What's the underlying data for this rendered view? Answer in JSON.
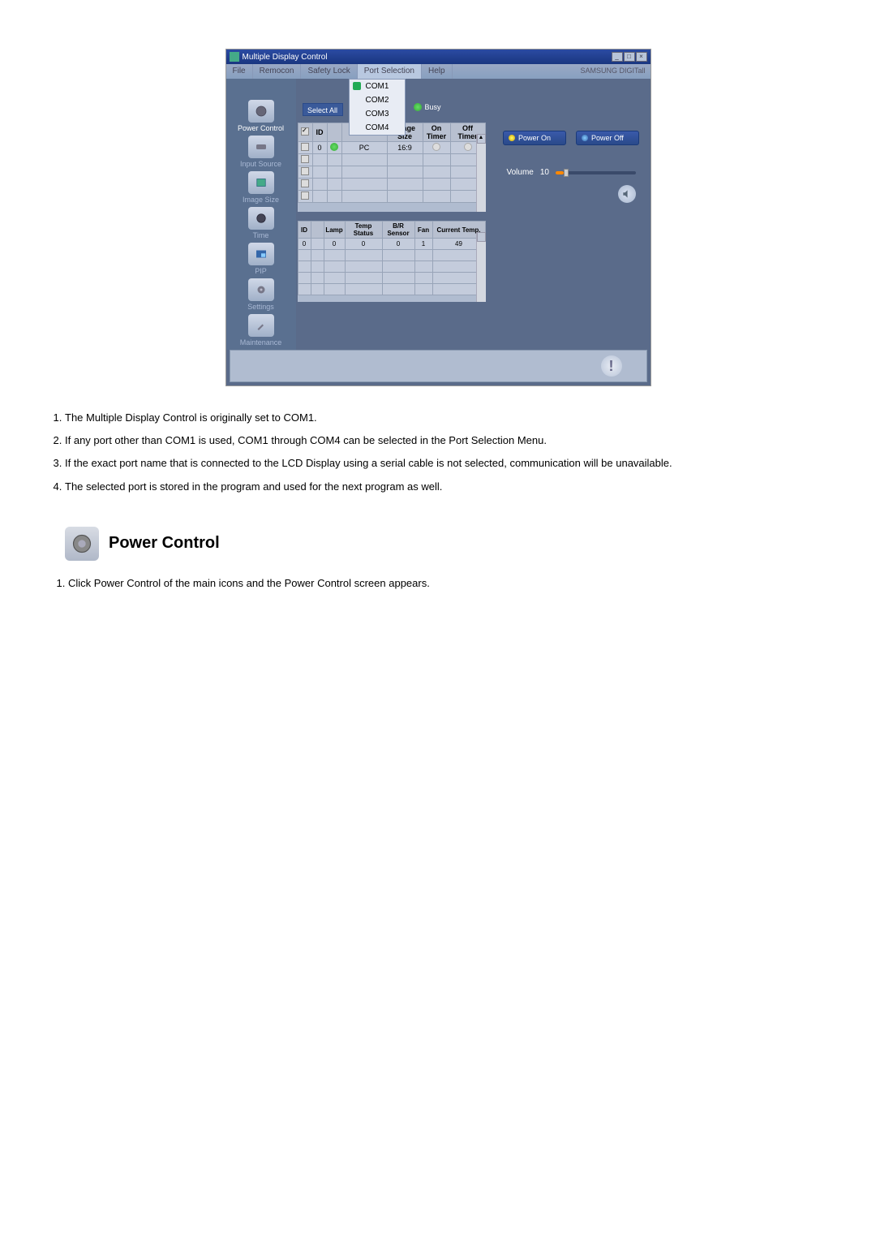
{
  "titlebar": {
    "title": "Multiple Display Control"
  },
  "menubar": {
    "items": [
      "File",
      "Remocon",
      "Safety Lock",
      "Port Selection",
      "Help"
    ],
    "brand": "SAMSUNG DIGITall"
  },
  "dropdown": {
    "items": [
      "COM1",
      "COM2",
      "COM3",
      "COM4"
    ],
    "checked_index": 0
  },
  "sidebar": {
    "items": [
      {
        "label": "Power Control"
      },
      {
        "label": "Input Source"
      },
      {
        "label": "Image Size"
      },
      {
        "label": "Time"
      },
      {
        "label": "PIP"
      },
      {
        "label": "Settings"
      },
      {
        "label": "Maintenance"
      }
    ]
  },
  "select_all_label": "Select All",
  "busy_label": "Busy",
  "grid1": {
    "headers": [
      "",
      "ID",
      "",
      "",
      "Image Size",
      "On Timer",
      "Off Timer"
    ],
    "row": {
      "id": "0",
      "input": "PC",
      "image_size": "16:9"
    }
  },
  "grid2": {
    "headers": [
      "ID",
      "",
      "Lamp",
      "Temp Status",
      "B/R Sensor",
      "Fan",
      "Current Temp."
    ],
    "row": {
      "id": "0",
      "lamp": "0",
      "temp_status": "0",
      "br_sensor": "0",
      "fan": "1",
      "current_temp": "49"
    }
  },
  "controls": {
    "power_on": "Power On",
    "power_off": "Power Off",
    "volume_label": "Volume",
    "volume_value": "10"
  },
  "notes": [
    "The Multiple Display Control is originally set to COM1.",
    "If any port other than COM1 is used, COM1 through COM4 can be selected in the Port Selection Menu.",
    "If the exact port name that is connected to the LCD Display using a serial cable is not selected, communication will be unavailable.",
    "The selected port is stored in the program and used for the next program as well."
  ],
  "section": {
    "title": "Power Control",
    "notes": [
      "Click Power Control of the main icons and the Power Control screen appears."
    ]
  }
}
